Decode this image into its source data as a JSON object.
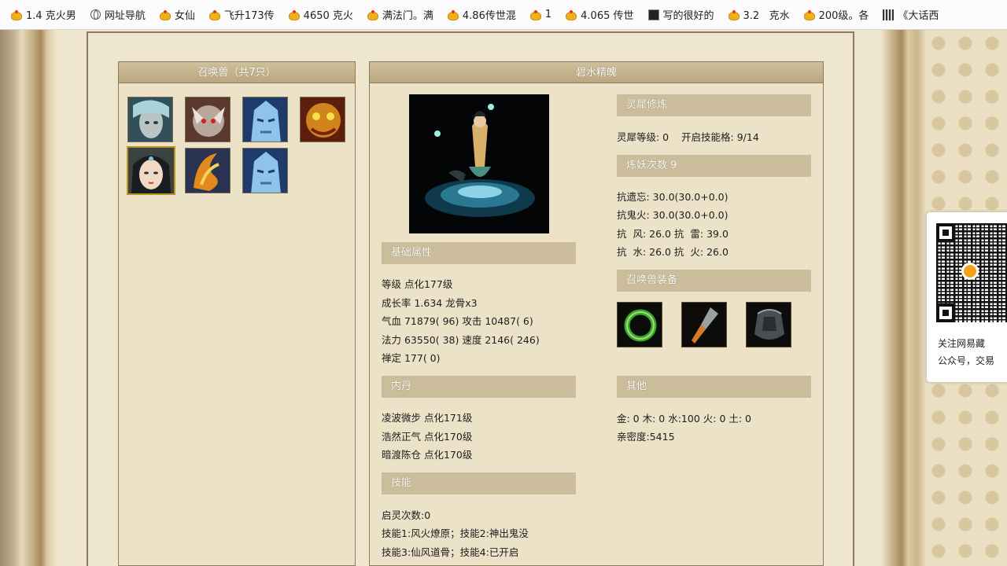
{
  "bookmarks": [
    {
      "label": "1.4 克火男",
      "icon": "coin-icon"
    },
    {
      "label": "网址导航",
      "icon": "globe-icon"
    },
    {
      "label": "女仙",
      "icon": "coin-icon"
    },
    {
      "label": "飞升173传",
      "icon": "coin-icon"
    },
    {
      "label": "4650 克火",
      "icon": "coin-icon"
    },
    {
      "label": "满法门。满",
      "icon": "coin-icon"
    },
    {
      "label": "4.86传世混",
      "icon": "coin-icon"
    },
    {
      "label": "1",
      "icon": "coin-icon"
    },
    {
      "label": "4.065 传世",
      "icon": "coin-icon"
    },
    {
      "label": "写的很好的",
      "icon": "dark-page-icon"
    },
    {
      "label": "3.2   克水",
      "icon": "coin-icon"
    },
    {
      "label": "200级。各",
      "icon": "coin-icon"
    },
    {
      "label": "《大话西",
      "icon": "qr-page-icon"
    }
  ],
  "summon_panel": {
    "title": "召唤兽（共7只）"
  },
  "pets": [
    {
      "name": "pet-1",
      "selected": false
    },
    {
      "name": "pet-2",
      "selected": false
    },
    {
      "name": "pet-3",
      "selected": false
    },
    {
      "name": "pet-4",
      "selected": false
    },
    {
      "name": "pet-5",
      "selected": true
    },
    {
      "name": "pet-6",
      "selected": false
    },
    {
      "name": "pet-7",
      "selected": false
    }
  ],
  "detail_panel": {
    "title": "碧水精魄"
  },
  "basic": {
    "heading": "基础属性",
    "lines": [
      "等级 点化177级",
      "成长率 1.634 龙骨x3",
      "气血 71879( 96) 攻击 10487( 6)",
      "法力 63550( 38) 速度 2146( 246)",
      "禅定 177( 0)"
    ]
  },
  "inner_dan": {
    "heading": "内丹",
    "lines": [
      "凌波微步 点化171级",
      "浩然正气 点化170级",
      "暗渡陈仓 点化170级"
    ]
  },
  "skills": {
    "heading": "技能",
    "lines": [
      "启灵次数:0",
      "技能1:风火燎原；技能2:神出鬼没",
      "技能3:仙风道骨；技能4:已开启"
    ]
  },
  "lingxi": {
    "heading": "灵犀修炼",
    "line": "灵犀等级: 0    开启技能格: 9/14"
  },
  "lianyao": {
    "heading": "炼妖次数 9",
    "lines": [
      "抗遗忘: 30.0(30.0+0.0)",
      "抗鬼火: 30.0(30.0+0.0)",
      "抗  风: 26.0 抗  雷: 39.0",
      "抗  水: 26.0 抗  火: 26.0"
    ]
  },
  "equipment": {
    "heading": "召唤兽装备",
    "items": [
      "green-ring",
      "dagger",
      "armor"
    ]
  },
  "other": {
    "heading": "其他",
    "lines": [
      "金: 0 木: 0 水:100 火: 0 土: 0",
      "亲密度:5415"
    ]
  },
  "qr_card": {
    "line1": "关注网易藏",
    "line2": "公众号，交易"
  }
}
